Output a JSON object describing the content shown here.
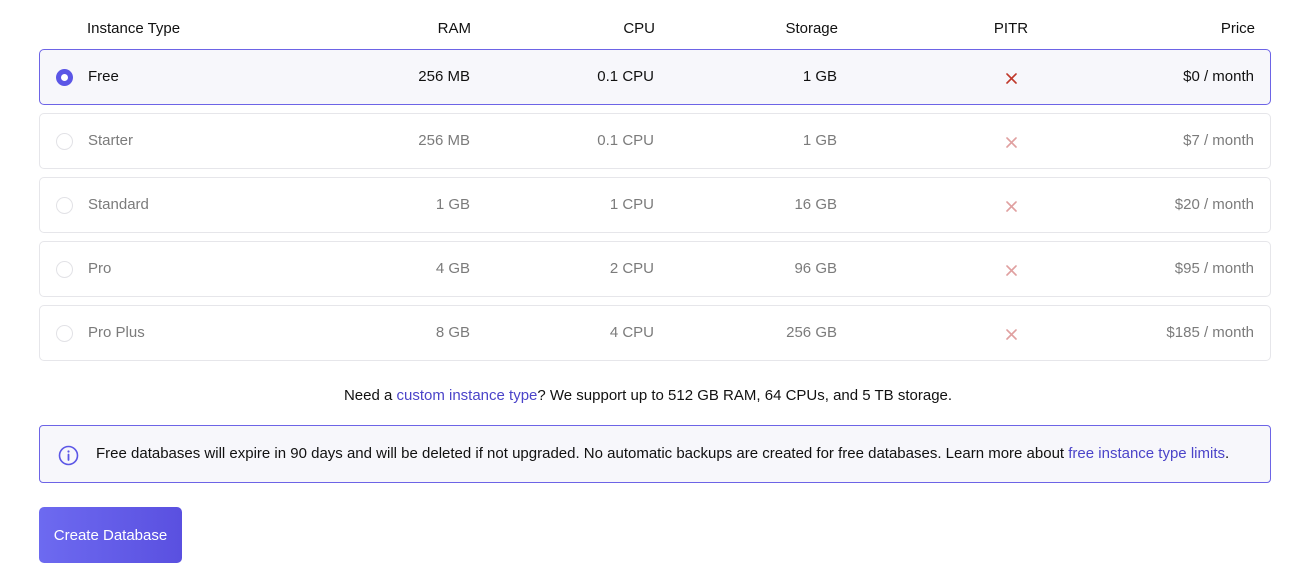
{
  "table": {
    "headers": {
      "instance_type": "Instance Type",
      "ram": "RAM",
      "cpu": "CPU",
      "storage": "Storage",
      "pitr": "PITR",
      "price": "Price"
    },
    "rows": [
      {
        "name": "Free",
        "ram": "256 MB",
        "cpu": "0.1 CPU",
        "storage": "1 GB",
        "price": "$0",
        "price_suffix": " / month",
        "selected": true
      },
      {
        "name": "Starter",
        "ram": "256 MB",
        "cpu": "0.1 CPU",
        "storage": "1 GB",
        "price": "$7",
        "price_suffix": " / month",
        "selected": false
      },
      {
        "name": "Standard",
        "ram": "1 GB",
        "cpu": "1 CPU",
        "storage": "16 GB",
        "price": "$20",
        "price_suffix": " / month",
        "selected": false
      },
      {
        "name": "Pro",
        "ram": "4 GB",
        "cpu": "2 CPU",
        "storage": "96 GB",
        "price": "$95",
        "price_suffix": " / month",
        "selected": false
      },
      {
        "name": "Pro Plus",
        "ram": "8 GB",
        "cpu": "4 CPU",
        "storage": "256 GB",
        "price": "$185",
        "price_suffix": " / month",
        "selected": false
      }
    ],
    "pitr_icon": "x-icon"
  },
  "note": {
    "prefix": "Need a ",
    "link": "custom instance type",
    "suffix": "? We support up to 512 GB RAM, 64 CPUs, and 5 TB storage."
  },
  "info": {
    "icon": "info-icon",
    "text": "Free databases will expire in 90 days and will be deleted if not upgraded. No automatic backups are created for free databases. Learn more about ",
    "link": "free instance type limits",
    "end": "."
  },
  "create_button": "Create Database",
  "colors": {
    "accent": "#5b56e6",
    "link": "#4b44c9",
    "x_mark": "#c0392b"
  }
}
